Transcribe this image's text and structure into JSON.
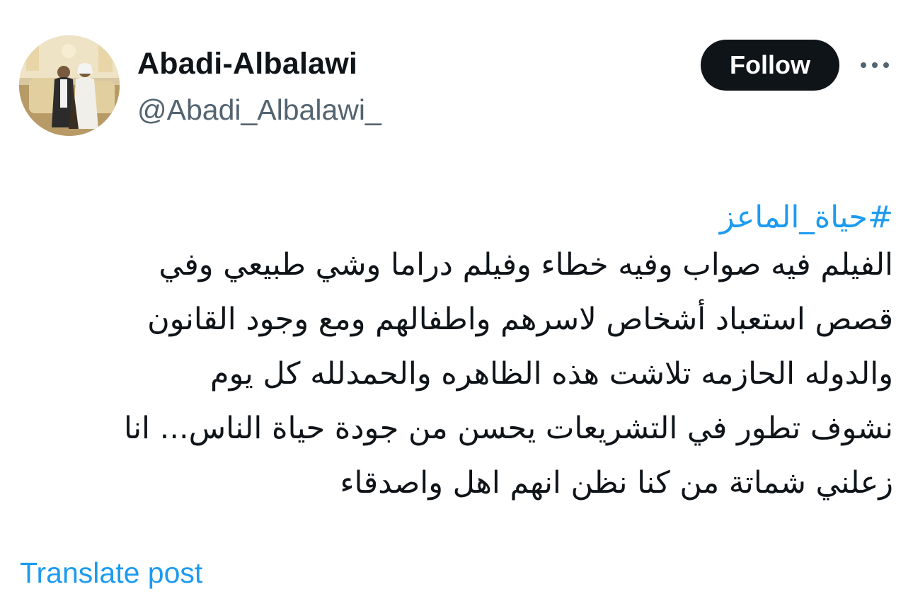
{
  "author": {
    "display_name": "Abadi-Albalawi",
    "handle": "@Abadi_Albalawi_"
  },
  "actions": {
    "follow_label": "Follow",
    "more_icon": "more-dots-icon"
  },
  "tweet": {
    "hashtag": "#حياة_الماعز",
    "lines": [
      "الفيلم فيه صواب وفيه خطاء وفيلم  دراما وشي طبيعي وفي",
      "قصص استعباد أشخاص لاسرهم واطفالهم ومع وجود القانون",
      "والدوله الحازمه تلاشت هذه الظاهره والحمدلله كل يوم",
      "نشوف تطور في التشريعات يحسن من جودة حياة الناس... انا",
      "زعلني شماتة من كنا نظن انهم اهل واصدقاء"
    ]
  },
  "footer": {
    "translate_label": "Translate post"
  },
  "colors": {
    "link": "#1d9bf0",
    "text": "#0f1419",
    "secondary": "#536471",
    "follow_bg": "#0f1419"
  }
}
